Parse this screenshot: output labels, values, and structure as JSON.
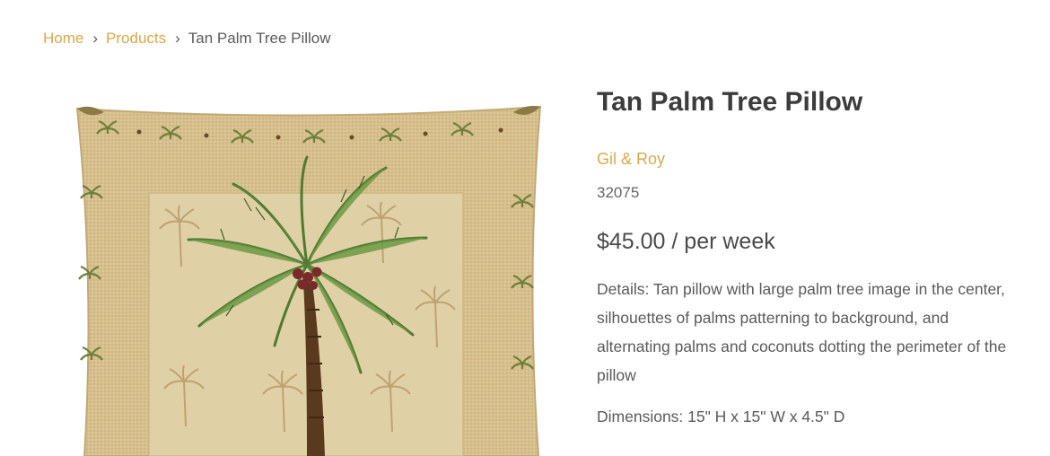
{
  "breadcrumb": {
    "home": "Home",
    "products": "Products",
    "current": "Tan Palm Tree Pillow",
    "separator": "›"
  },
  "product": {
    "title": "Tan Palm Tree Pillow",
    "brand": "Gil & Roy",
    "sku": "32075",
    "price": "$45.00 / per week",
    "details": "Details: Tan pillow with large palm tree image in the center, silhouettes of palms patterning to background, and alternating palms and coconuts dotting the perimeter of the pillow",
    "dimensions": "Dimensions: 15\" H x 15\" W x 4.5\" D",
    "image_icon": "palm-tree-pillow-image"
  },
  "colors": {
    "accent": "#d8a94a",
    "text": "#4a4a4a",
    "pillow_base": "#d9c392",
    "palm_green": "#5e8a3a",
    "trunk_brown": "#5a3a1e"
  }
}
